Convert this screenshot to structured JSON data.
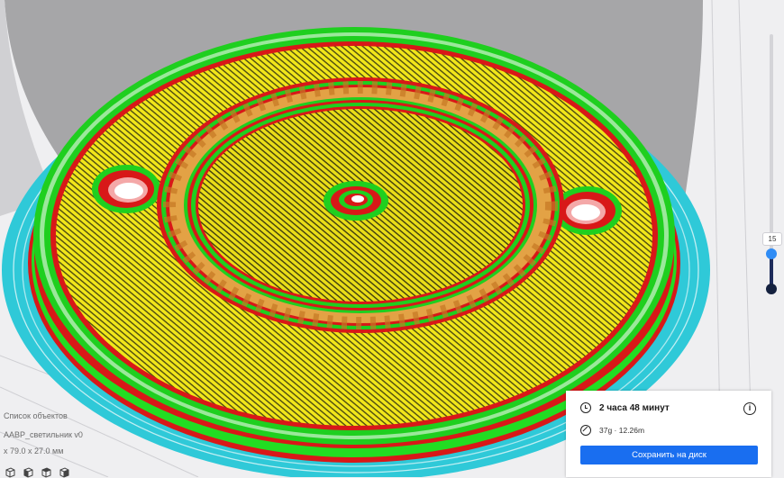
{
  "object_list": {
    "title": "Список объектов",
    "object_name": "AAВP_светильник v0",
    "dimensions": "x 79.0 x 27.0 мм",
    "view_buttons": [
      "view-3d-icon",
      "view-front-icon",
      "view-top-icon",
      "view-left-icon",
      "view-right-icon"
    ]
  },
  "layer_slider": {
    "current_layer": "15"
  },
  "print_info": {
    "time": "2 часа 48 минут",
    "material": "37g · 12.26m",
    "save_button": "Сохранить на диск"
  },
  "colors": {
    "accent": "#196ef0",
    "skirt": "#33d3e0",
    "wall_outer": "#e01d1d",
    "wall_inner": "#22dd22",
    "top_skin": "#f2e818",
    "infill": "#e8a23a",
    "build_plate": "#efeff1"
  }
}
